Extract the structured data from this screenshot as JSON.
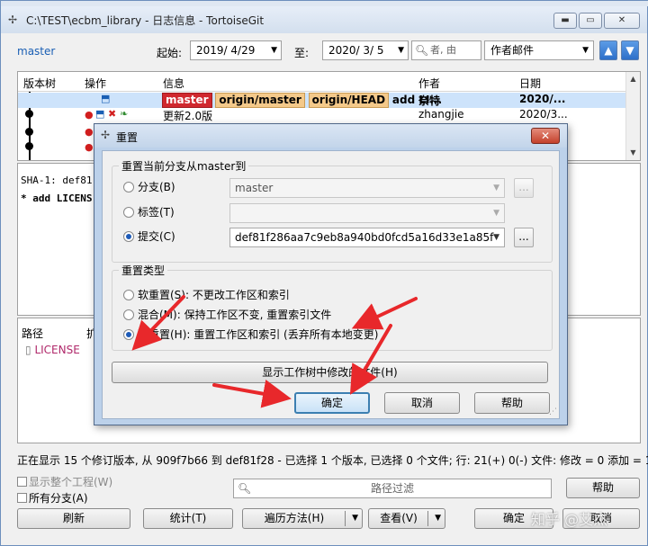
{
  "window": {
    "title": "C:\\TEST\\ecbm_library - 日志信息 - TortoiseGit",
    "controls": [
      "minimize",
      "maximize",
      "close"
    ]
  },
  "toolbar": {
    "branch": "master",
    "from_label": "起始:",
    "from_date": "2019/  4/29",
    "to_label": "至:",
    "to_date": "2020/  3/  5",
    "search_placeholder": "者, 由",
    "filter_by": "作者邮件"
  },
  "log": {
    "columns": [
      "版本树",
      "操作",
      "信息",
      "作者",
      "日期"
    ],
    "rows": [
      {
        "refs": [
          {
            "text": "master",
            "style": "red"
          },
          {
            "text": "origin/master",
            "style": "orange"
          },
          {
            "text": "origin/HEAD",
            "style": "orange"
          }
        ],
        "message": "add LI...",
        "author": "奈特",
        "date": "2020/...",
        "selected": true
      },
      {
        "refs": [],
        "message": "更新2.0版",
        "author": "zhangjie",
        "date": "2020/3...",
        "selected": false
      }
    ]
  },
  "message_pane": {
    "lines": [
      "SHA-1: def81",
      "* add LICENS"
    ]
  },
  "files": {
    "headers": [
      "路径",
      "扩"
    ],
    "items": [
      "LICENSE"
    ]
  },
  "status": {
    "text": "正在显示 15 个修订版本, 从 909f7b66 到 def81f28 - 已选择 1 个版本, 已选择 0 个文件; 行: 21(+) 0(-) 文件: 修改 = 0 添加 = 1"
  },
  "bottom": {
    "show_whole_project": "显示整个工程(W)",
    "all_branches": "所有分支(A)",
    "path_filter_placeholder": "路径过滤",
    "help": "帮助",
    "refresh": "刷新",
    "statistics": "统计(T)",
    "walk_method": "遍历方法(H)",
    "view": "查看(V)",
    "ok": "确定",
    "cancel": "取消"
  },
  "dialog": {
    "title": "重置",
    "group1_title": "重置当前分支从master到",
    "options": [
      {
        "label": "分支(B)",
        "value": "master",
        "selected": false
      },
      {
        "label": "标签(T)",
        "value": "",
        "selected": false
      },
      {
        "label": "提交(C)",
        "value": "def81f286aa7c9eb8a940bd0fcd5a16d33e1a85f",
        "selected": true
      }
    ],
    "ellipsis": "...",
    "group2_title": "重置类型",
    "reset_types": [
      {
        "label": "软重置(S): 不更改工作区和索引",
        "selected": false
      },
      {
        "label": "混合(M): 保持工作区不变, 重置索引文件",
        "selected": false
      },
      {
        "label": "硬重置(H): 重置工作区和索引 (丢弃所有本地变更)",
        "selected": true
      }
    ],
    "show_worktree_button": "显示工作树中修改的文件(H)",
    "ok": "确定",
    "cancel": "取消",
    "help": "帮助"
  },
  "watermark": "知乎 @艾杰",
  "colors": {
    "annotation_arrow": "#e8282b",
    "selected_row": "#cde3fb",
    "tag_master": "#d0282e",
    "tag_origin": "#f4c98a"
  }
}
